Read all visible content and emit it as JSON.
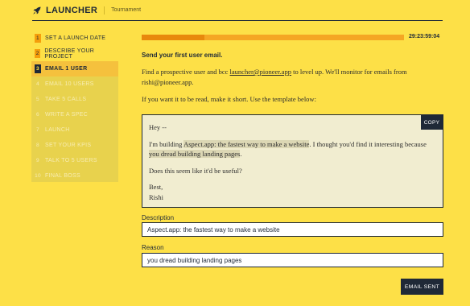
{
  "header": {
    "logo": "LAUNCHER",
    "subtitle": "Tournament"
  },
  "steps": [
    {
      "num": "1",
      "label": "SET A LAUNCH DATE",
      "state": "done"
    },
    {
      "num": "2",
      "label": "DESCRIBE YOUR PROJECT",
      "state": "done"
    },
    {
      "num": "3",
      "label": "EMAIL 1 USER",
      "state": "active"
    },
    {
      "num": "4",
      "label": "EMAIL 10 USERS",
      "state": "locked"
    },
    {
      "num": "5",
      "label": "TAKE 5 CALLS",
      "state": "locked"
    },
    {
      "num": "6",
      "label": "WRITE A SPEC",
      "state": "locked"
    },
    {
      "num": "7",
      "label": "LAUNCH",
      "state": "locked"
    },
    {
      "num": "8",
      "label": "SET YOUR KPIS",
      "state": "locked"
    },
    {
      "num": "9",
      "label": "TALK TO 5 USERS",
      "state": "locked"
    },
    {
      "num": "10",
      "label": "FINAL BOSS",
      "state": "locked"
    }
  ],
  "progress": {
    "fraction": 0.24,
    "timer": "29:23:59:04"
  },
  "main": {
    "title": "Send your first user email.",
    "intro_pre": "Find a prospective user and bcc ",
    "intro_link": "launcher@pioneer.app",
    "intro_post": " to level up. We'll monitor for emails from rishi@pioneer.app.",
    "instruction": "If you want it to be read, make it short. Use the template below:"
  },
  "template": {
    "greeting": "Hey --",
    "line_pre": "I'm building ",
    "line_hl1": "Aspect.app: the fastest way to make a website",
    "line_mid": ". I thought you'd find it interesting because ",
    "line_hl2": "you dread building landing pages",
    "line_end": ".",
    "question": "Does this seem like it'd be useful?",
    "signoff": "Best,",
    "name": "Rishi",
    "copy_label": "COPY"
  },
  "form": {
    "description_label": "Description",
    "description_value": "Aspect.app: the fastest way to make a website",
    "reason_label": "Reason",
    "reason_value": "you dread building landing pages",
    "submit_label": "EMAIL SENT"
  }
}
